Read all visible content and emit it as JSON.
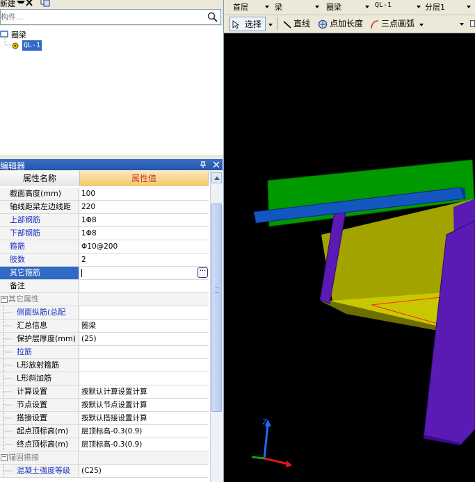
{
  "left_toolbar": {
    "new_label": "新建",
    "delete_icon": "delete-x-icon",
    "copy_icon": "copy-icon"
  },
  "search": {
    "placeholder": "构件..."
  },
  "tree": {
    "root_label": "圈梁",
    "child_label": "QL-1"
  },
  "editor": {
    "title": "属性编辑器",
    "pin_icon": "pin-icon",
    "close_icon": "close-icon"
  },
  "table": {
    "header_name": "属性名称",
    "header_value": "属性值",
    "rows": [
      {
        "name": "截面高度(mm)",
        "value": "100",
        "style": "normal"
      },
      {
        "name": "轴线距梁左边线距",
        "value": "220",
        "style": "normal"
      },
      {
        "name": "上部钢筋",
        "value": "1Φ8",
        "style": "blue"
      },
      {
        "name": "下部钢筋",
        "value": "1Φ8",
        "style": "blue"
      },
      {
        "name": "箍筋",
        "value": "Φ10@200",
        "style": "blue"
      },
      {
        "name": "肢数",
        "value": "2",
        "style": "blue"
      },
      {
        "name": "其它箍筋",
        "value": "",
        "style": "selected"
      },
      {
        "name": "备注",
        "value": "",
        "style": "normal"
      },
      {
        "name": "其它属性",
        "value": "",
        "style": "group"
      },
      {
        "name": "侧面纵筋(总配",
        "value": "",
        "style": "child-blue"
      },
      {
        "name": "汇总信息",
        "value": "圈梁",
        "style": "child"
      },
      {
        "name": "保护层厚度(mm)",
        "value": "(25)",
        "style": "child"
      },
      {
        "name": "拉筋",
        "value": "",
        "style": "child-blue"
      },
      {
        "name": "L形放射箍筋",
        "value": "",
        "style": "child"
      },
      {
        "name": "L形斜加筋",
        "value": "",
        "style": "child"
      },
      {
        "name": "计算设置",
        "value": "按默认计算设置计算",
        "style": "child"
      },
      {
        "name": "节点设置",
        "value": "按默认节点设置计算",
        "style": "child"
      },
      {
        "name": "搭接设置",
        "value": "按默认搭接设置计算",
        "style": "child"
      },
      {
        "name": "起点顶标高(m)",
        "value": "层顶标高-0.3(0.9)",
        "style": "child"
      },
      {
        "name": "终点顶标高(m)",
        "value": "层顶标高-0.3(0.9)",
        "style": "child"
      },
      {
        "name": "锚固搭接",
        "value": "",
        "style": "group"
      },
      {
        "name": "混凝土强度等级",
        "value": "(C25)",
        "style": "child-blue"
      }
    ]
  },
  "right_toolbar1": {
    "floor": "首层",
    "category": "梁",
    "type": "圈梁",
    "component": "QL-1",
    "layer": "分层1"
  },
  "right_toolbar2": {
    "select": "选择",
    "line": "直线",
    "point_length": "点加长度",
    "arc": "三点画弧"
  },
  "axes": {
    "z": "Z"
  },
  "colors": {
    "beam_yellow": "#a3a300",
    "slab_green": "#009a00",
    "column_purple": "#5a1ab4",
    "bar_blue": "#1456c0",
    "background": "#000000",
    "selection": "#316ac5"
  }
}
